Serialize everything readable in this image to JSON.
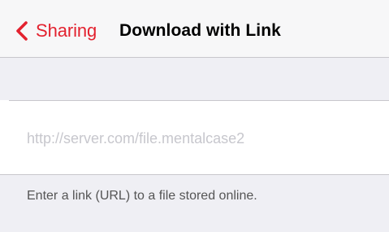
{
  "navbar": {
    "back_label": "Sharing",
    "title": "Download with Link",
    "accent_color": "#e3222f",
    "back_icon": "chevron-left-icon"
  },
  "url_field": {
    "value": "",
    "placeholder": "http://server.com/file.mentalcase2"
  },
  "footer": {
    "hint": "Enter a link (URL) to a file stored online."
  }
}
